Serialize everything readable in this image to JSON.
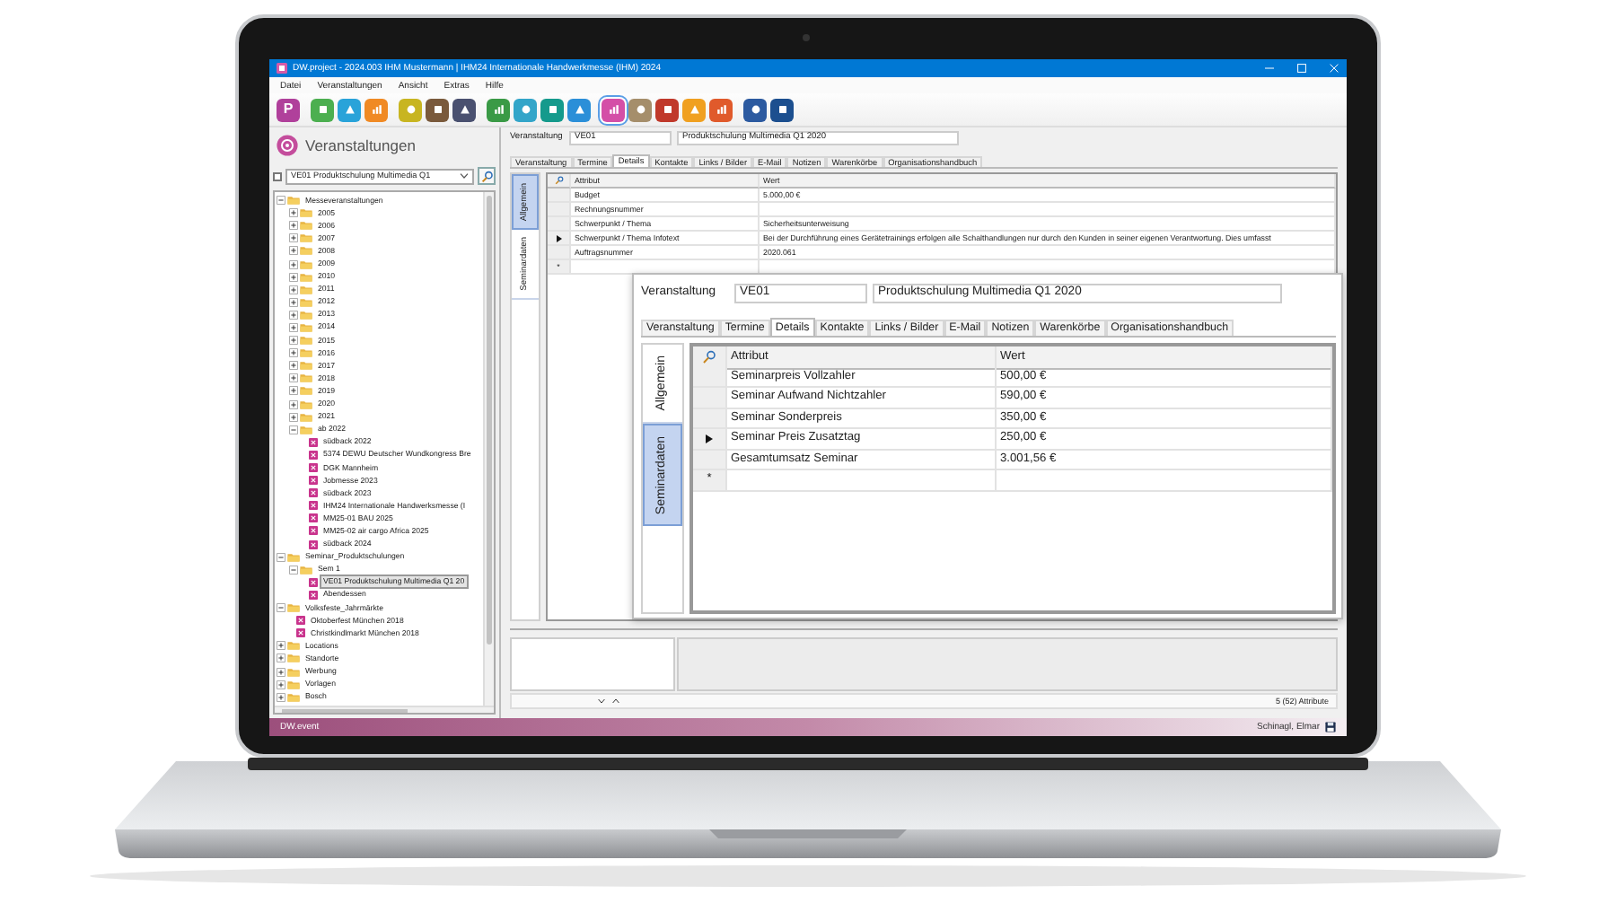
{
  "window": {
    "title": "DW.project - 2024.003 IHM Mustermann | IHM24 Internationale Handwerkmesse (IHM) 2024"
  },
  "menu": [
    "Datei",
    "Veranstaltungen",
    "Ansicht",
    "Extras",
    "Hilfe"
  ],
  "toolbar": [
    [
      {
        "label": "P",
        "selected": false
      }
    ],
    [
      {
        "selected": false
      },
      {
        "selected": false
      },
      {
        "selected": false
      }
    ],
    [
      {
        "selected": false
      },
      {
        "selected": false
      },
      {
        "selected": false
      }
    ],
    [
      {
        "selected": false
      },
      {
        "selected": false
      },
      {
        "selected": false
      },
      {
        "selected": false
      }
    ],
    [
      {
        "selected": true
      },
      {
        "selected": false
      },
      {
        "selected": false
      },
      {
        "selected": false
      },
      {
        "selected": false
      }
    ],
    [
      {
        "selected": false
      },
      {
        "selected": false
      }
    ]
  ],
  "sidebar": {
    "title": "Veranstaltungen",
    "selector": {
      "checked": false,
      "value": "VE01 Produktschulung Multimedia Q1"
    },
    "tree": [
      {
        "label": "Messeveranstaltungen",
        "kind": "folder",
        "expanded": true,
        "children": [
          {
            "label": "2005",
            "kind": "folder",
            "expanded": false
          },
          {
            "label": "2006",
            "kind": "folder",
            "expanded": false
          },
          {
            "label": "2007",
            "kind": "folder",
            "expanded": false
          },
          {
            "label": "2008",
            "kind": "folder",
            "expanded": false
          },
          {
            "label": "2009",
            "kind": "folder",
            "expanded": false
          },
          {
            "label": "2010",
            "kind": "folder",
            "expanded": false
          },
          {
            "label": "2011",
            "kind": "folder",
            "expanded": false
          },
          {
            "label": "2012",
            "kind": "folder",
            "expanded": false
          },
          {
            "label": "2013",
            "kind": "folder",
            "expanded": false
          },
          {
            "label": "2014",
            "kind": "folder",
            "expanded": false
          },
          {
            "label": "2015",
            "kind": "folder",
            "expanded": false
          },
          {
            "label": "2016",
            "kind": "folder",
            "expanded": false
          },
          {
            "label": "2017",
            "kind": "folder",
            "expanded": false
          },
          {
            "label": "2018",
            "kind": "folder",
            "expanded": false
          },
          {
            "label": "2019",
            "kind": "folder",
            "expanded": false
          },
          {
            "label": "2020",
            "kind": "folder",
            "expanded": false
          },
          {
            "label": "2021",
            "kind": "folder",
            "expanded": false
          },
          {
            "label": "ab 2022",
            "kind": "folder",
            "expanded": true,
            "children": [
              {
                "label": "südback 2022",
                "kind": "event",
                "selected": false
              },
              {
                "label": "5374 DEWU Deutscher Wundkongress Bre",
                "kind": "event",
                "selected": false
              },
              {
                "label": "DGK Mannheim",
                "kind": "event",
                "selected": false
              },
              {
                "label": "Jobmesse 2023",
                "kind": "event",
                "selected": false
              },
              {
                "label": "südback 2023",
                "kind": "event",
                "selected": false
              },
              {
                "label": "IHM24 Internationale Handwerksmesse (I",
                "kind": "event",
                "selected": false
              },
              {
                "label": "MM25-01 BAU 2025",
                "kind": "event",
                "selected": false
              },
              {
                "label": "MM25-02 air cargo Africa 2025",
                "kind": "event",
                "selected": false
              },
              {
                "label": "südback 2024",
                "kind": "event",
                "selected": false
              }
            ]
          }
        ]
      },
      {
        "label": "Seminar_Produktschulungen",
        "kind": "folder",
        "expanded": true,
        "children": [
          {
            "label": "Sem 1",
            "kind": "folder",
            "expanded": true,
            "children": [
              {
                "label": "VE01 Produktschulung Multimedia Q1 20",
                "kind": "event",
                "selected": true
              },
              {
                "label": "Abendessen",
                "kind": "event",
                "selected": false
              }
            ]
          }
        ]
      },
      {
        "label": "Volksfeste_Jahrmärkte",
        "kind": "folder",
        "expanded": true,
        "children": [
          {
            "label": "Oktoberfest München 2018",
            "kind": "event",
            "selected": false
          },
          {
            "label": "Christkindlmarkt München 2018",
            "kind": "event",
            "selected": false
          }
        ]
      },
      {
        "label": "Locations",
        "kind": "folder",
        "expanded": false
      },
      {
        "label": "Standorte",
        "kind": "folder",
        "expanded": false
      },
      {
        "label": "Werbung",
        "kind": "folder",
        "expanded": false
      },
      {
        "label": "Vorlagen",
        "kind": "folder",
        "expanded": false
      },
      {
        "label": "Bosch",
        "kind": "folder",
        "expanded": false
      }
    ]
  },
  "details": {
    "header": {
      "label": "Veranstaltung",
      "code": "VE01",
      "name": "Produktschulung Multimedia Q1 2020"
    },
    "tabs": [
      {
        "label": "Veranstaltung",
        "selected": false
      },
      {
        "label": "Termine",
        "selected": false
      },
      {
        "label": "Details",
        "selected": true
      },
      {
        "label": "Kontakte",
        "selected": false
      },
      {
        "label": "Links / Bilder",
        "selected": false
      },
      {
        "label": "E-Mail",
        "selected": false
      },
      {
        "label": "Notizen",
        "selected": false
      },
      {
        "label": "Warenkörbe",
        "selected": false
      },
      {
        "label": "Organisationshandbuch",
        "selected": false
      }
    ],
    "side_tabs": [
      {
        "label": "Allgemein",
        "selected": true
      },
      {
        "label": "Seminardaten",
        "selected": false
      }
    ],
    "grid": {
      "columns": [
        "Attribut",
        "Wert"
      ],
      "rows": [
        {
          "attribute": "Budget",
          "value": "5.000,00 €",
          "current": false
        },
        {
          "attribute": "Rechnungsnummer",
          "current": false
        },
        {
          "attribute": "Schwerpunkt / Thema",
          "value": "Sicherheitsunterweisung",
          "current": false
        },
        {
          "attribute": "Schwerpunkt / Thema Infotext",
          "value": "Bei der Durchführung eines Gerätetrainings erfolgen alle Schalthandlungen nur durch den Kunden in seiner eigenen Verantwortung. Dies umfasst",
          "current": true
        },
        {
          "attribute": "Auftragsnummer",
          "value": "2020.061",
          "current": false
        }
      ],
      "new_row_marker": "*"
    },
    "footer": {
      "count": "5 (52) Attribute"
    }
  },
  "inset": {
    "header": {
      "label": "Veranstaltung",
      "code": "VE01",
      "name": "Produktschulung Multimedia Q1 2020"
    },
    "tabs": [
      {
        "label": "Veranstaltung",
        "selected": false
      },
      {
        "label": "Termine",
        "selected": false
      },
      {
        "label": "Details",
        "selected": true
      },
      {
        "label": "Kontakte",
        "selected": false
      },
      {
        "label": "Links / Bilder",
        "selected": false
      },
      {
        "label": "E-Mail",
        "selected": false
      },
      {
        "label": "Notizen",
        "selected": false
      },
      {
        "label": "Warenkörbe",
        "selected": false
      },
      {
        "label": "Organisationshandbuch",
        "selected": false
      }
    ],
    "side_tabs": [
      {
        "label": "Allgemein",
        "selected": false
      },
      {
        "label": "Seminardaten",
        "selected": true
      }
    ],
    "grid": {
      "columns": [
        "Attribut",
        "Wert"
      ],
      "rows": [
        {
          "attribute": "Seminarpreis Vollzahler",
          "value": "500,00 €",
          "current": false
        },
        {
          "attribute": "Seminar Aufwand Nichtzahler",
          "value": "590,00 €",
          "current": false
        },
        {
          "attribute": "Seminar Sonderpreis",
          "value": "350,00 €",
          "current": false
        },
        {
          "attribute": "Seminar Preis Zusatztag",
          "value": "250,00 €",
          "current": true
        },
        {
          "attribute": "Gesamtumsatz Seminar",
          "value": "3.001,56 €",
          "current": false
        }
      ],
      "new_row_marker": "*"
    }
  },
  "status_bar": {
    "app": "DW.event",
    "user": "Schinagl, Elmar"
  }
}
